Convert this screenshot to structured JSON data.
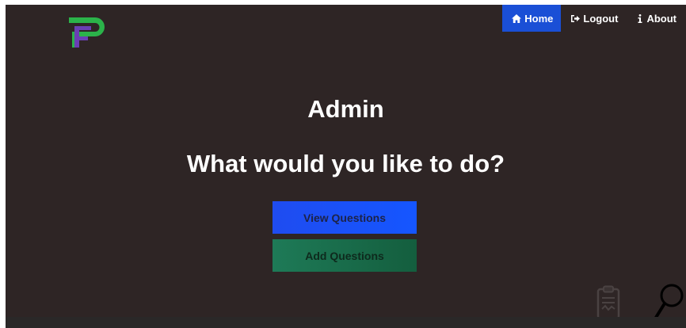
{
  "nav": {
    "items": [
      {
        "label": "Home",
        "icon": "home-icon",
        "active": true
      },
      {
        "label": "Logout",
        "icon": "logout-icon",
        "active": false
      },
      {
        "label": "About",
        "icon": "info-icon",
        "active": false
      }
    ]
  },
  "main": {
    "role_title": "Admin",
    "prompt": "What would you like to do?",
    "actions": {
      "view_label": "View Questions",
      "add_label": "Add Questions"
    }
  },
  "colors": {
    "background": "#2e2525",
    "nav_active": "#1a4fd6",
    "view_button": "#1556ff",
    "add_button": "#1a7050",
    "logo_green": "#2bb34a",
    "logo_purple": "#6a3fb4"
  },
  "icons": {
    "logo": "brand-logo-icon",
    "clipboard": "clipboard-icon",
    "magnifier": "magnifier-icon"
  }
}
